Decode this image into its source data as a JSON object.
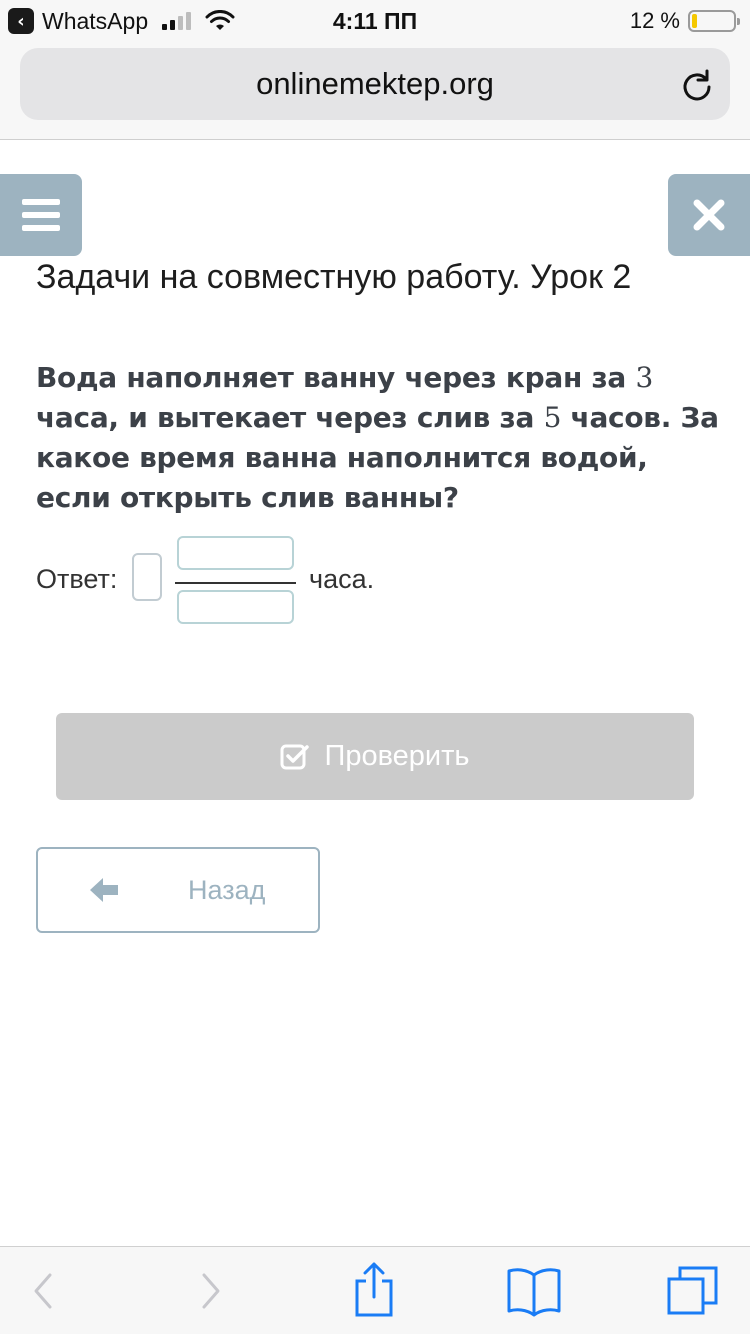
{
  "status_bar": {
    "back_app": "WhatsApp",
    "time": "4:11 ПП",
    "battery_text": "12 %",
    "battery_level": 0.12,
    "battery_color": "#f5c800",
    "icons": [
      "back-chevron-icon",
      "signal-icon",
      "wifi-icon",
      "battery-icon"
    ]
  },
  "browser": {
    "url": "onlinemektep.org",
    "reload_icon": "reload-icon"
  },
  "page": {
    "menu_icon": "hamburger-icon",
    "close_icon": "close-icon",
    "accent_color": "#9db3c0",
    "title": "Задачи на совместную работу. Урок 2",
    "question": {
      "part1": "Вода наполняет ванну через кран за ",
      "num1": "3",
      "part2": " часа, и вытекает через слив за ",
      "num2": "5",
      "part3": " часов. За какое время ванна наполнится водой, если открыть слив ванны?"
    },
    "answer": {
      "label": "Ответ:",
      "whole_value": "",
      "numerator_value": "",
      "denominator_value": "",
      "unit": "часа."
    },
    "check_button": {
      "label": "Проверить",
      "icon": "checkbox-icon",
      "color": "#cbcbcb"
    },
    "back_button": {
      "label": "Назад",
      "icon": "arrow-left-icon"
    }
  },
  "toolbar": {
    "icons": [
      "back-icon",
      "forward-icon",
      "share-icon",
      "bookmarks-icon",
      "tabs-icon"
    ],
    "tint": "#1a7cf5"
  }
}
